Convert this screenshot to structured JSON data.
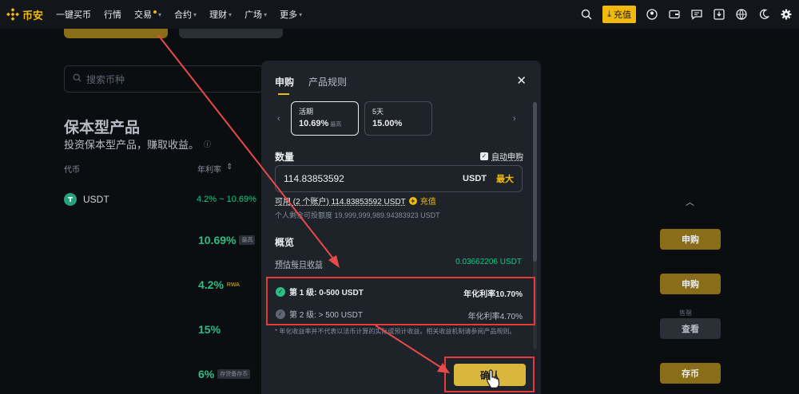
{
  "nav": {
    "logo_text": "币安",
    "items": [
      {
        "label": "一键买币",
        "caret": false
      },
      {
        "label": "行情",
        "caret": false
      },
      {
        "label": "交易",
        "caret": true
      },
      {
        "label": "合约",
        "caret": true
      },
      {
        "label": "理财",
        "caret": true
      },
      {
        "label": "广场",
        "caret": true
      },
      {
        "label": "更多",
        "caret": true
      }
    ],
    "deposit_label": "充值"
  },
  "page": {
    "search_placeholder": "搜索币种",
    "title": "保本型产品",
    "subtitle": "投资保本型产品，赚取收益。",
    "col_coin": "代币",
    "col_rate": "年利率",
    "usdt_name": "USDT",
    "usdt_rate": "4.2% ~ 10.69%",
    "rows": [
      {
        "rate": "10.69%",
        "tag": "最高",
        "button": "申购"
      },
      {
        "rate": "4.2%",
        "tag": "RWA",
        "button": "申购"
      },
      {
        "rate": "15%",
        "tag": "",
        "button": "查看"
      },
      {
        "rate": "6%",
        "tag": "存贷备存币",
        "button": "存币"
      }
    ],
    "sold_label": "售罄"
  },
  "modal": {
    "tab_subscribe": "申购",
    "tab_rules": "产品规则",
    "period_cards": [
      {
        "key": "活期",
        "value": "10.69%",
        "note": "最高"
      },
      {
        "key": "5天",
        "value": "15.00%",
        "note": ""
      }
    ],
    "amount_label": "数量",
    "auto_subscribe": "自动申购",
    "amount_value": "114.83853592",
    "amount_unit": "USDT",
    "max_label": "最大",
    "available_text": "可用 (2 个账户) 114.83853592 USDT",
    "deposit_link": "充值",
    "quota_text": "个人剩余可投额度 19,999,999,989.94383923 USDT",
    "overview_label": "概览",
    "est_label": "预估每日收益",
    "est_value": "0.03662206 USDT",
    "tiers": [
      {
        "label": "第 1 级:  0-500 USDT",
        "rate": "年化利率10.70%",
        "active": true
      },
      {
        "label": "第 2 级:  > 500 USDT",
        "rate": "年化利率4.70%",
        "active": false
      }
    ],
    "note": "* 年化收益率并不代表以法币计算的实际或预计收益。相关收益机制请参阅产品规则。",
    "confirm_label": "确认"
  },
  "colors": {
    "accent": "#f0b90b",
    "positive": "#0ecb81",
    "highlight": "#e53a3a"
  }
}
